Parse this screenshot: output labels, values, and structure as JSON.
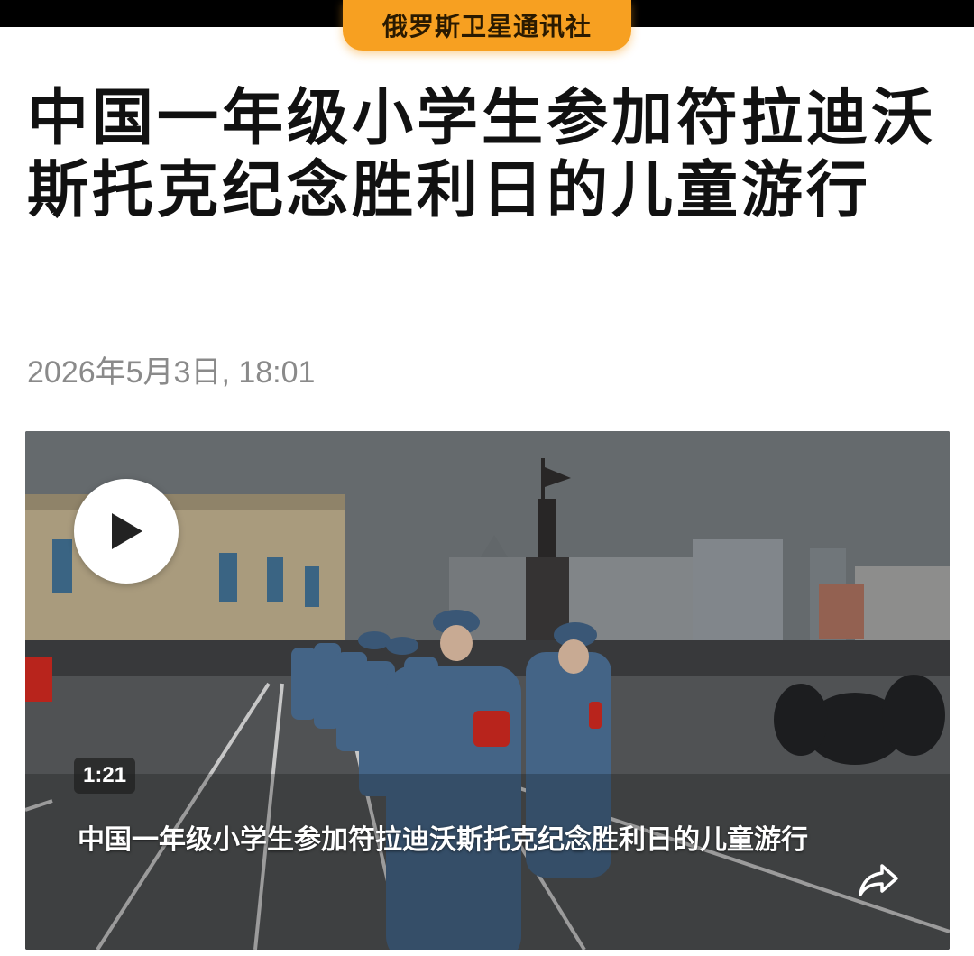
{
  "header": {
    "source_label": "俄罗斯卫星通讯社"
  },
  "article": {
    "title": "中国一年级小学生参加符拉迪沃斯托克纪念胜利日的儿童游行",
    "timestamp": "2026年5月3日, 18:01"
  },
  "video": {
    "duration": "1:21",
    "caption": "中国一年级小学生参加符拉迪沃斯托克纪念胜利日的儿童游行",
    "play_icon": "play-icon",
    "share_icon": "share-icon"
  },
  "colors": {
    "accent": "#f7a021",
    "title": "#111111",
    "timestamp": "#8a8a8a"
  }
}
